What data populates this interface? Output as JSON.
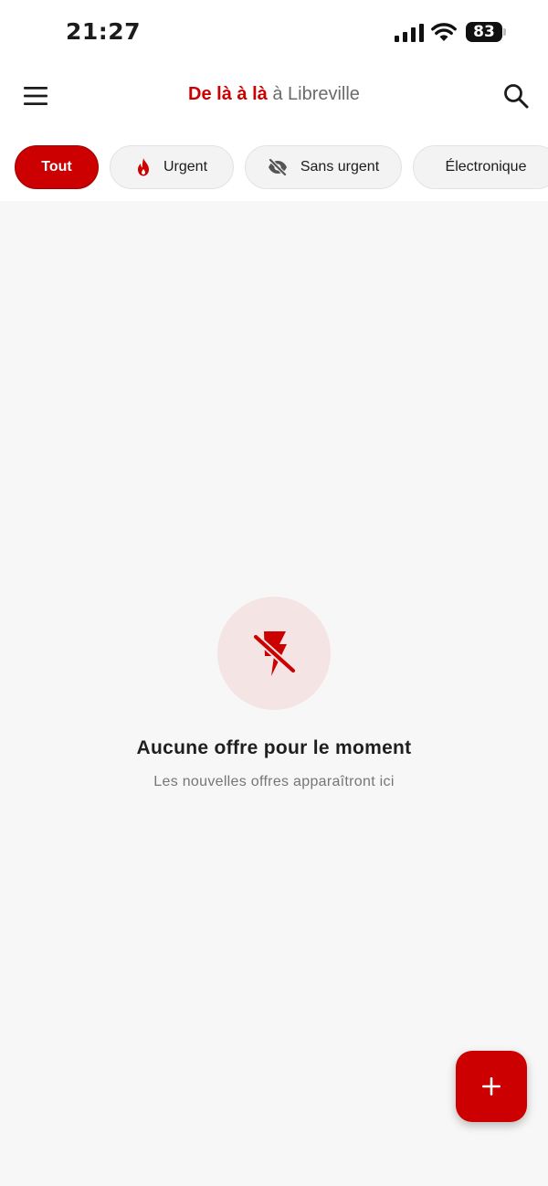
{
  "status_bar": {
    "time": "21:27",
    "battery": "83",
    "icons": [
      "signal-icon",
      "wifi-icon",
      "battery-icon"
    ]
  },
  "app_bar": {
    "brand": "De là à là",
    "city_suffix": "à Libreville",
    "icons": [
      "menu-icon",
      "search-icon"
    ]
  },
  "filters": [
    {
      "label": "Tout",
      "active": true
    },
    {
      "label": "Urgent",
      "icon": "flame-icon",
      "active": false
    },
    {
      "label": "Sans urgent",
      "icon": "eye-off-icon",
      "active": false
    },
    {
      "label": "Électronique",
      "active": false
    }
  ],
  "empty_state": {
    "icon": "flash-off-icon",
    "title": "Aucune offre pour le moment",
    "subtitle": "Les nouvelles offres apparaîtront ici"
  },
  "fab": {
    "icon": "plus-icon"
  },
  "colors": {
    "accent": "#cc0000",
    "accent_soft": "#f4e4e4",
    "background": "#f7f7f7",
    "surface": "#ffffff"
  }
}
